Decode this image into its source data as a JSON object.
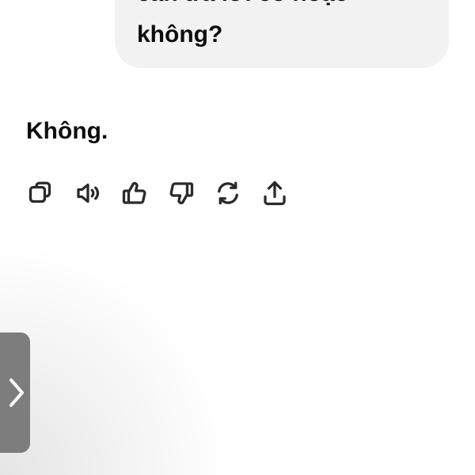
{
  "conversation": {
    "user_message": {
      "lines": [
        "cần trả lời có hoặc",
        "không?"
      ]
    },
    "assistant_message": {
      "text": "Không."
    }
  },
  "message_actions": {
    "icons": [
      "copy-icon",
      "read-aloud-icon",
      "thumbs-up-icon",
      "thumbs-down-icon",
      "regenerate-icon",
      "share-icon"
    ]
  },
  "drawer_toggle": {
    "icon": "chevron-right-icon"
  },
  "colors": {
    "bubble_background": "#f2f2f2",
    "text": "#0d0d0d",
    "icon_stroke": "#2a2a2a",
    "drawer_toggle_background": "#7d7d7d"
  }
}
